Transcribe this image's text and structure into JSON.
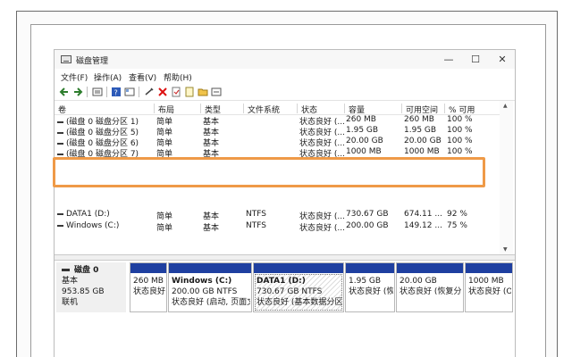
{
  "window": {
    "title": "磁盘管理",
    "controls": {
      "minimize": "—",
      "maximize": "☐",
      "close": "✕"
    }
  },
  "menu": [
    "文件(F)",
    "操作(A)",
    "查看(V)",
    "帮助(H)"
  ],
  "toolbar_icons": [
    "back-arrow-icon",
    "forward-arrow-icon",
    "volume-list-icon",
    "help-icon",
    "properties-icon",
    "connect-icon",
    "delete-x-icon",
    "check-icon",
    "new-volume-icon",
    "folder-search-icon",
    "rescan-icon"
  ],
  "volume_table": {
    "columns": [
      "卷",
      "布局",
      "类型",
      "文件系统",
      "状态",
      "容量",
      "可用空间",
      "% 可用"
    ],
    "rows": [
      {
        "volume": "(磁盘 0 磁盘分区 1)",
        "layout": "简单",
        "type": "基本",
        "fs": "",
        "status": "状态良好 (...",
        "capacity": "260 MB",
        "free": "260 MB",
        "pct": "100 %"
      },
      {
        "volume": "(磁盘 0 磁盘分区 5)",
        "layout": "简单",
        "type": "基本",
        "fs": "",
        "status": "状态良好 (...",
        "capacity": "1.95 GB",
        "free": "1.95 GB",
        "pct": "100 %"
      },
      {
        "volume": "(磁盘 0 磁盘分区 6)",
        "layout": "简单",
        "type": "基本",
        "fs": "",
        "status": "状态良好 (...",
        "capacity": "20.00 GB",
        "free": "20.00 GB",
        "pct": "100 %"
      },
      {
        "volume": "(磁盘 0 磁盘分区 7)",
        "layout": "简单",
        "type": "基本",
        "fs": "",
        "status": "状态良好 (...",
        "capacity": "1000 MB",
        "free": "1000 MB",
        "pct": "100 %"
      },
      {
        "volume": "DATA1 (D:)",
        "layout": "简单",
        "type": "基本",
        "fs": "NTFS",
        "status": "状态良好 (...",
        "capacity": "730.67 GB",
        "free": "674.11 ...",
        "pct": "92 %"
      },
      {
        "volume": "Windows (C:)",
        "layout": "简单",
        "type": "基本",
        "fs": "NTFS",
        "status": "状态良好 (...",
        "capacity": "200.00 GB",
        "free": "149.12 ...",
        "pct": "75 %"
      }
    ]
  },
  "highlight_color": "#ef9a47",
  "partition_bar_color": "#1e3fa0",
  "disk": {
    "name": "磁盘 0",
    "type": "基本",
    "size": "953.85 GB",
    "status": "联机",
    "partitions": [
      {
        "name": "",
        "size": "260 MB",
        "status": "状态良好"
      },
      {
        "name": "Windows (C:)",
        "size": "200.00 GB NTFS",
        "status": "状态良好 (启动, 页面文"
      },
      {
        "name": "DATA1 (D:)",
        "size": "730.67 GB NTFS",
        "status": "状态良好 (基本数据分区)"
      },
      {
        "name": "",
        "size": "1.95 GB",
        "status": "状态良好 (恢"
      },
      {
        "name": "",
        "size": "20.00 GB",
        "status": "状态良好 (恢复分"
      },
      {
        "name": "",
        "size": "1000 MB",
        "status": "状态良好 (O"
      }
    ]
  }
}
